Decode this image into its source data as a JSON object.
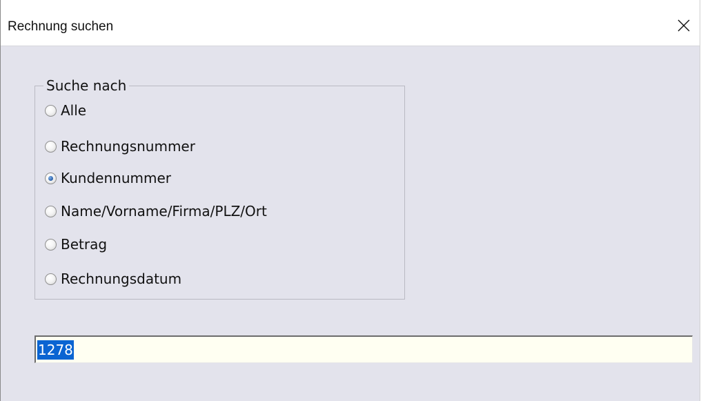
{
  "window": {
    "title": "Rechnung suchen",
    "close_icon": "close-icon"
  },
  "search_group": {
    "legend": "Suche nach",
    "options": [
      {
        "label": "Alle",
        "selected": false
      },
      {
        "label": "Rechnungsnummer",
        "selected": false
      },
      {
        "label": "Kundennummer",
        "selected": true
      },
      {
        "label": "Name/Vorname/Firma/PLZ/Ort",
        "selected": false
      },
      {
        "label": "Betrag",
        "selected": false
      },
      {
        "label": "Rechnungsdatum",
        "selected": false
      }
    ]
  },
  "search_input": {
    "value": "1278"
  },
  "colors": {
    "dialog_background": "#e3e3ec",
    "input_background": "#fffff2",
    "selection": "#0a64d2"
  }
}
